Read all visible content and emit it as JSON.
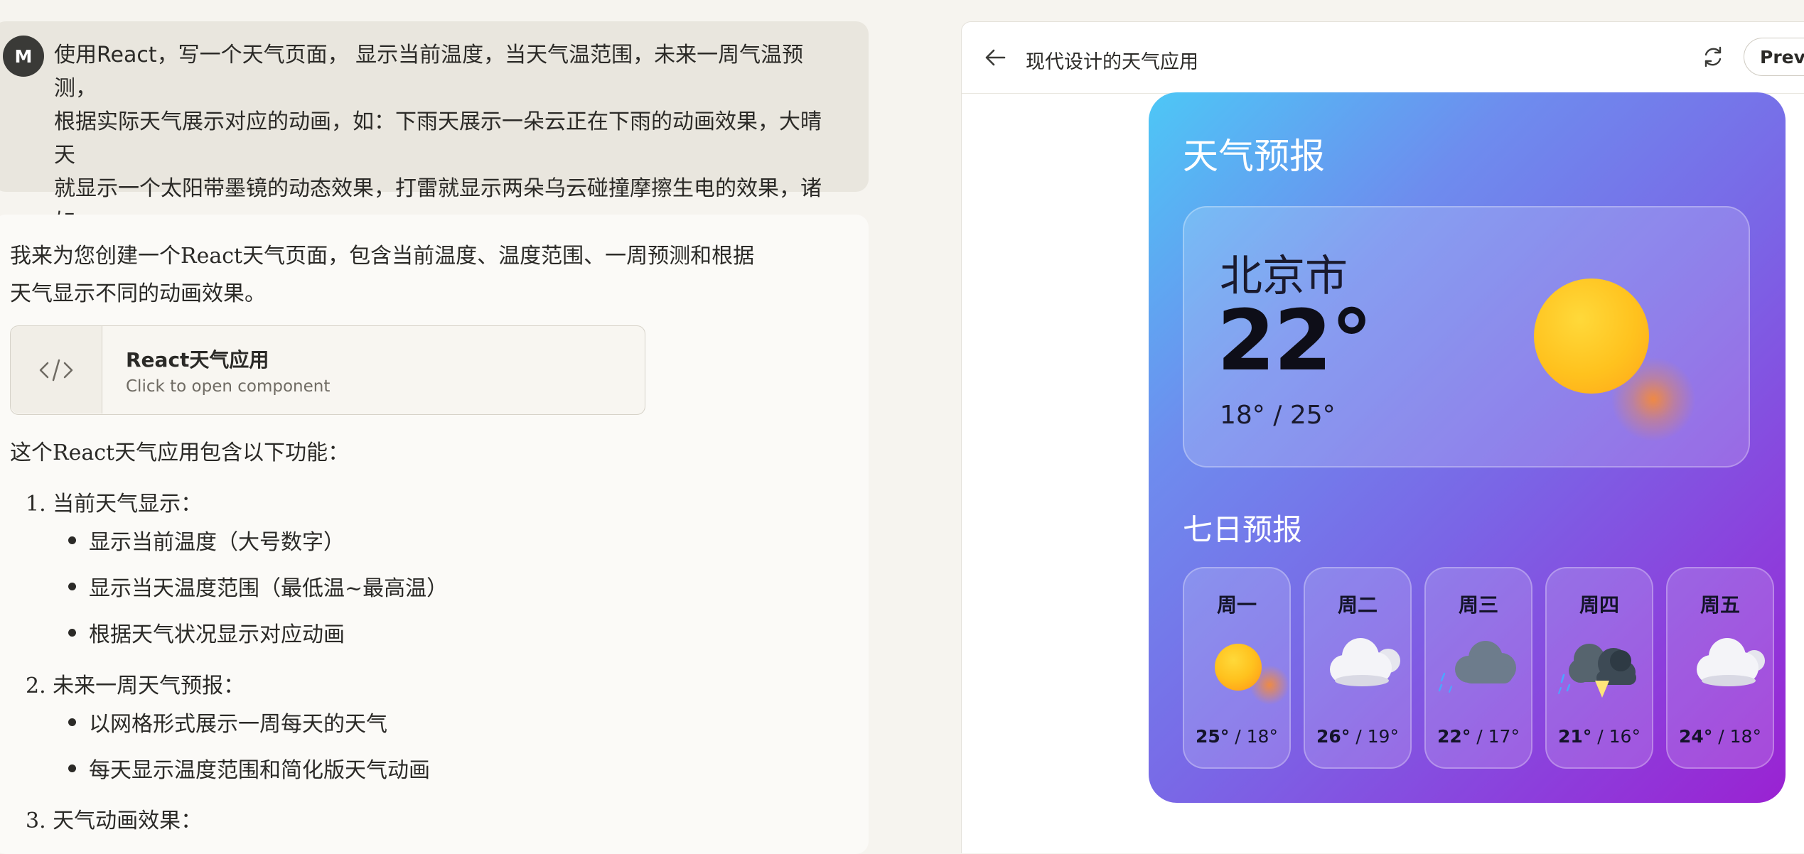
{
  "chat": {
    "user": {
      "avatar_initial": "M",
      "lines": [
        "使用React，写一个天气页面， 显示当前温度，当天气温范围，未来一周气温预测，",
        "根据实际天气展示对应的动画，如：下雨天展示一朵云正在下雨的动画效果，大晴天",
        "就显示一个太阳带墨镜的动态效果，打雷就显示两朵乌云碰撞摩擦生电的效果，诸如",
        "此类"
      ]
    },
    "assistant": {
      "intro_lines": [
        "我来为您创建一个React天气页面，包含当前温度、温度范围、一周预测和根据",
        "天气显示不同的动画效果。"
      ],
      "artifact": {
        "icon": "code-icon",
        "title": "React天气应用",
        "subtitle": "Click to open component"
      },
      "features_intro": "这个React天气应用包含以下功能：",
      "sections": [
        {
          "heading": "1. 当前天气显示：",
          "items": [
            "显示当前温度（大号数字）",
            "显示当天温度范围（最低温~最高温）",
            "根据天气状况显示对应动画"
          ]
        },
        {
          "heading": "2. 未来一周天气预报：",
          "items": [
            "以网格形式展示一周每天的天气",
            "每天显示温度范围和简化版天气动画"
          ]
        },
        {
          "heading": "3. 天气动画效果：",
          "items": []
        }
      ]
    }
  },
  "preview": {
    "back_icon": "arrow-left-icon",
    "title": "现代设计的天气应用",
    "refresh_icon": "refresh-icon",
    "preview_button": "Previe"
  },
  "weather": {
    "app_title": "天气预报",
    "city": "北京市",
    "current_temp": "22°",
    "temp_range": "18° / 25°",
    "current_condition_icon": "sun-icon",
    "forecast_title": "七日预报",
    "days": [
      {
        "name": "周一",
        "high": "25°",
        "low": "18°",
        "icon": "sun-icon"
      },
      {
        "name": "周二",
        "high": "26°",
        "low": "19°",
        "icon": "cloud-icon"
      },
      {
        "name": "周三",
        "high": "22°",
        "low": "17°",
        "icon": "rain-cloud-icon"
      },
      {
        "name": "周四",
        "high": "21°",
        "low": "16°",
        "icon": "thunderstorm-icon"
      },
      {
        "name": "周五",
        "high": "24°",
        "low": "18°",
        "icon": "cloud-icon"
      }
    ]
  },
  "colors": {
    "user_bubble": "#e9e6de",
    "page_bg": "#f6f4ef",
    "gradient_start": "#4dc7f6",
    "gradient_end": "#9a22d2",
    "sun": "#ffc21e"
  }
}
